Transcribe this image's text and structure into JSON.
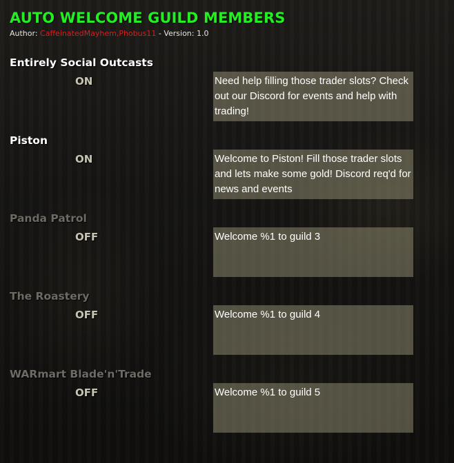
{
  "header": {
    "title": "AUTO WELCOME GUILD MEMBERS",
    "author_prefix": "Author: ",
    "author_names": "CaffeinatedMayhem,Phobus11",
    "version": " - Version: 1.0"
  },
  "guilds": [
    {
      "name": "Entirely Social Outcasts",
      "state": "ON",
      "message": "Need help filling those trader slots? Check out our Discord for events and help with trading!"
    },
    {
      "name": "Piston",
      "state": "ON",
      "message": "Welcome to Piston! Fill those trader slots and lets make some gold! Discord req'd for news and events"
    },
    {
      "name": "Panda Patrol",
      "state": "OFF",
      "message": "Welcome %1 to guild 3"
    },
    {
      "name": "The Roastery",
      "state": "OFF",
      "message": "Welcome %1 to guild 4"
    },
    {
      "name": "WARmart Blade'n'Trade",
      "state": "OFF",
      "message": "Welcome %1 to guild 5"
    }
  ],
  "colors": {
    "title": "#22ee22",
    "author_names": "#cc2222",
    "active_name": "#ffffff",
    "inactive_name": "#6e6a64",
    "toggle": "#c8c4b2",
    "message_box": "#96916e"
  }
}
